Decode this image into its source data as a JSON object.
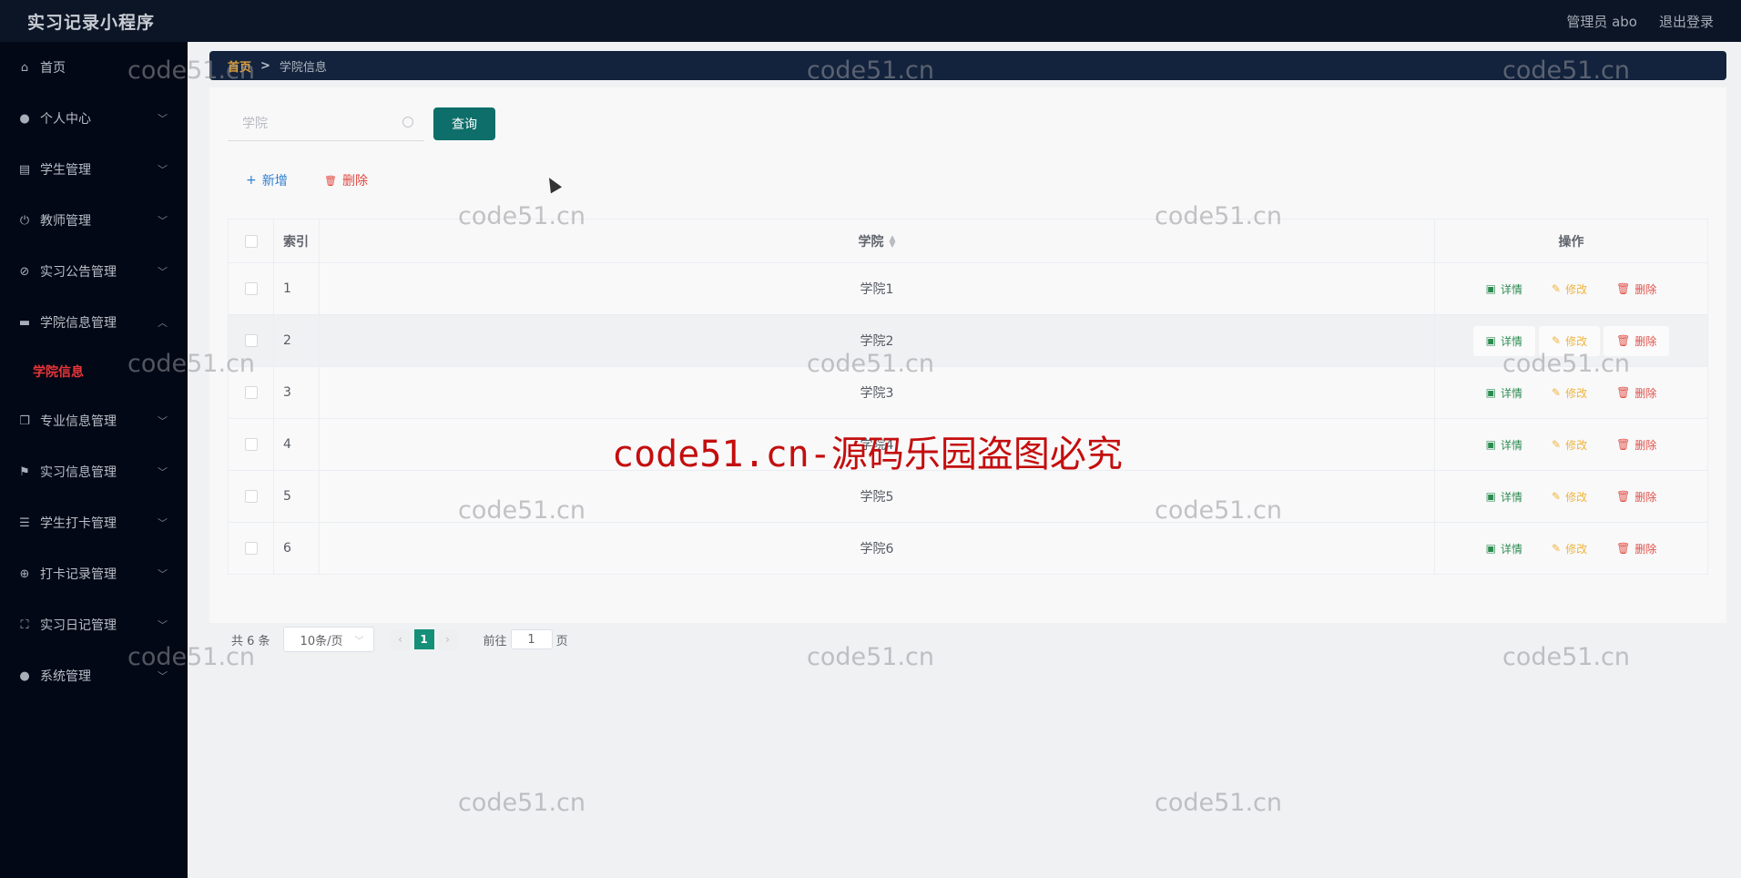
{
  "header": {
    "app_title": "实习记录小程序",
    "user_label": "管理员 abo",
    "logout_label": "退出登录"
  },
  "sidebar": {
    "items": [
      {
        "label": "首页",
        "icon": "home-icon",
        "glyph": "⌂",
        "expandable": false
      },
      {
        "label": "个人中心",
        "icon": "user-icon",
        "glyph": "●",
        "expandable": true
      },
      {
        "label": "学生管理",
        "icon": "clipboard-icon",
        "glyph": "▤",
        "expandable": true
      },
      {
        "label": "教师管理",
        "icon": "power-icon",
        "glyph": "⏻",
        "expandable": true
      },
      {
        "label": "实习公告管理",
        "icon": "compass-icon",
        "glyph": "⊘",
        "expandable": true
      },
      {
        "label": "学院信息管理",
        "icon": "monitor-icon",
        "glyph": "▬",
        "expandable": true,
        "expanded": true
      },
      {
        "label": "专业信息管理",
        "icon": "copy-icon",
        "glyph": "❐",
        "expandable": true
      },
      {
        "label": "实习信息管理",
        "icon": "flag-icon",
        "glyph": "⚑",
        "expandable": true
      },
      {
        "label": "学生打卡管理",
        "icon": "list-icon",
        "glyph": "☰",
        "expandable": true
      },
      {
        "label": "打卡记录管理",
        "icon": "target-icon",
        "glyph": "⊕",
        "expandable": true
      },
      {
        "label": "实习日记管理",
        "icon": "fullscreen-icon",
        "glyph": "⛶",
        "expandable": true
      },
      {
        "label": "系统管理",
        "icon": "user-icon",
        "glyph": "●",
        "expandable": true
      }
    ],
    "sub_item_active": "学院信息",
    "chevron_down": "﹀",
    "chevron_up": "︿"
  },
  "breadcrumb": {
    "home": "首页",
    "separator": ">",
    "current": "学院信息"
  },
  "search": {
    "placeholder": "学院",
    "value": "",
    "query_label": "查询"
  },
  "toolbar": {
    "add_label": "新增",
    "add_glyph": "+",
    "delete_label": "删除",
    "delete_glyph": "🗑"
  },
  "table": {
    "columns": [
      "",
      "索引",
      "学院",
      "操作"
    ],
    "sortable_column": "学院",
    "rows": [
      {
        "index": "1",
        "name": "学院1"
      },
      {
        "index": "2",
        "name": "学院2"
      },
      {
        "index": "3",
        "name": "学院3"
      },
      {
        "index": "4",
        "name": "学院4"
      },
      {
        "index": "5",
        "name": "学院5"
      },
      {
        "index": "6",
        "name": "学院6"
      }
    ],
    "hovered_row": 2,
    "actions": {
      "detail": "详情",
      "edit": "修改",
      "delete": "删除"
    }
  },
  "pagination": {
    "total_text": "共 6 条",
    "page_size": "10条/页",
    "current_page": "1",
    "goto_label": "前往",
    "goto_value": "1",
    "page_suffix": "页"
  },
  "watermark": {
    "small": "code51.cn",
    "big": "code51.cn-源码乐园盗图必究"
  },
  "colors": {
    "header_bg": "#0b1526",
    "sidebar_bg": "#030816",
    "active_sub": "#e8363a",
    "breadcrumb_bg": "#13233d",
    "breadcrumb_home": "#e0a03a",
    "query_btn": "#0d6e6a",
    "add": "#2f7fd0",
    "delete": "#e0493f",
    "detail": "#2c8c4f",
    "edit": "#efb43b",
    "page_current": "#149078",
    "watermark_big": "#c40e0e"
  }
}
